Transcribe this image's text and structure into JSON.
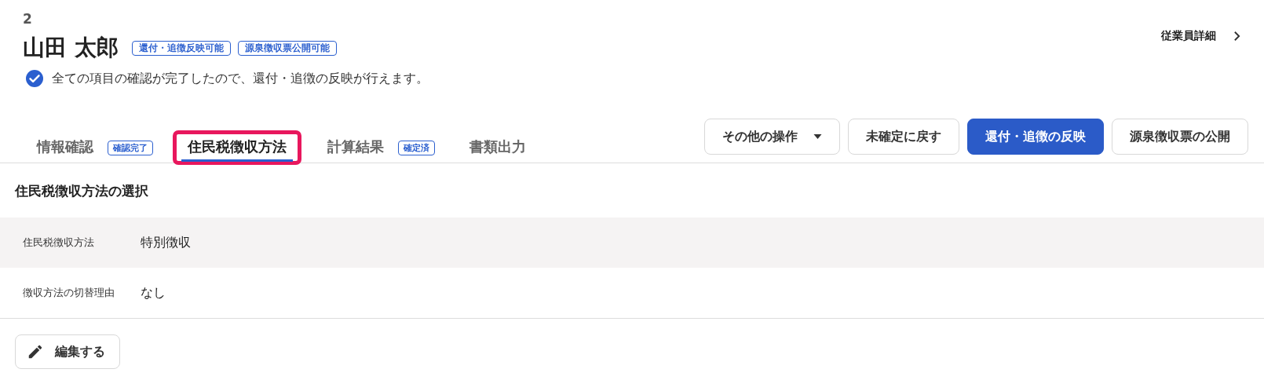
{
  "employee": {
    "number": "2",
    "name": "山田 太郎",
    "badges": [
      "還付・追徴反映可能",
      "源泉徴収票公開可能"
    ],
    "status_message": "全ての項目の確認が完了したので、還付・追徴の反映が行えます。",
    "detail_link": "従業員詳細"
  },
  "tabs": [
    {
      "label": "情報確認",
      "badge": "確認完了",
      "selected": false,
      "highlighted": false
    },
    {
      "label": "住民税徴収方法",
      "selected": true,
      "highlighted": true
    },
    {
      "label": "計算結果",
      "badge": "確定済",
      "selected": false,
      "highlighted": false
    },
    {
      "label": "書類出力",
      "selected": false,
      "highlighted": false
    }
  ],
  "actions": [
    {
      "label": "その他の操作",
      "kind": "dropdown"
    },
    {
      "label": "未確定に戻す",
      "kind": "secondary"
    },
    {
      "label": "還付・追徴の反映",
      "kind": "primary"
    },
    {
      "label": "源泉徴収票の公開",
      "kind": "secondary"
    }
  ],
  "section": {
    "title": "住民税徴収方法の選択",
    "fields": [
      {
        "label": "住民税徴収方法",
        "value": "特別徴収"
      },
      {
        "label": "徴収方法の切替理由",
        "value": "なし"
      }
    ],
    "edit_button": "編集する"
  }
}
